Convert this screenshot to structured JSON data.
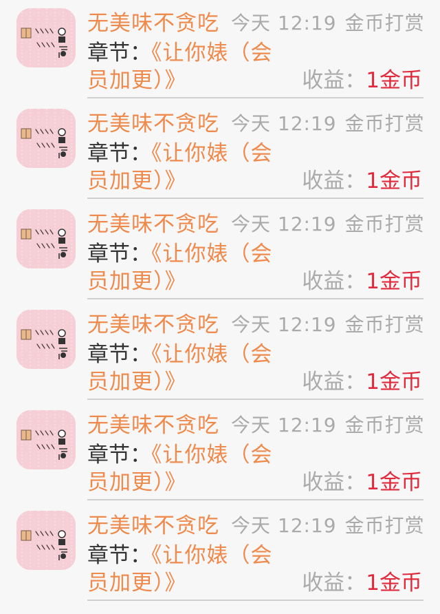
{
  "records": [
    {
      "nickname": "无美味不贪吃",
      "time": "今天 12:19",
      "action": "金币打赏",
      "chapter_label": "章节：",
      "chapter_part1": "《让你婊（会",
      "chapter_part2": "员加更）》",
      "income_label": "收益：",
      "income_value": "1金币",
      "avatar": "avatar-icon"
    },
    {
      "nickname": "无美味不贪吃",
      "time": "今天 12:19",
      "action": "金币打赏",
      "chapter_label": "章节：",
      "chapter_part1": "《让你婊（会",
      "chapter_part2": "员加更）》",
      "income_label": "收益：",
      "income_value": "1金币",
      "avatar": "avatar-icon"
    },
    {
      "nickname": "无美味不贪吃",
      "time": "今天 12:19",
      "action": "金币打赏",
      "chapter_label": "章节：",
      "chapter_part1": "《让你婊（会",
      "chapter_part2": "员加更）》",
      "income_label": "收益：",
      "income_value": "1金币",
      "avatar": "avatar-icon"
    },
    {
      "nickname": "无美味不贪吃",
      "time": "今天 12:19",
      "action": "金币打赏",
      "chapter_label": "章节：",
      "chapter_part1": "《让你婊（会",
      "chapter_part2": "员加更）》",
      "income_label": "收益：",
      "income_value": "1金币",
      "avatar": "avatar-icon"
    },
    {
      "nickname": "无美味不贪吃",
      "time": "今天 12:19",
      "action": "金币打赏",
      "chapter_label": "章节：",
      "chapter_part1": "《让你婊（会",
      "chapter_part2": "员加更）》",
      "income_label": "收益：",
      "income_value": "1金币",
      "avatar": "avatar-icon"
    },
    {
      "nickname": "无美味不贪吃",
      "time": "今天 12:19",
      "action": "金币打赏",
      "chapter_label": "章节：",
      "chapter_part1": "《让你婊（会",
      "chapter_part2": "员加更）》",
      "income_label": "收益：",
      "income_value": "1金币",
      "avatar": "avatar-icon"
    }
  ],
  "colors": {
    "accent_orange": "#ef8a4d",
    "meta_gray": "#aaaaaa",
    "income_red": "#e02a3c",
    "text_dark": "#333333",
    "avatar_pink": "#f6cfd6",
    "background": "#f8f7f8"
  }
}
